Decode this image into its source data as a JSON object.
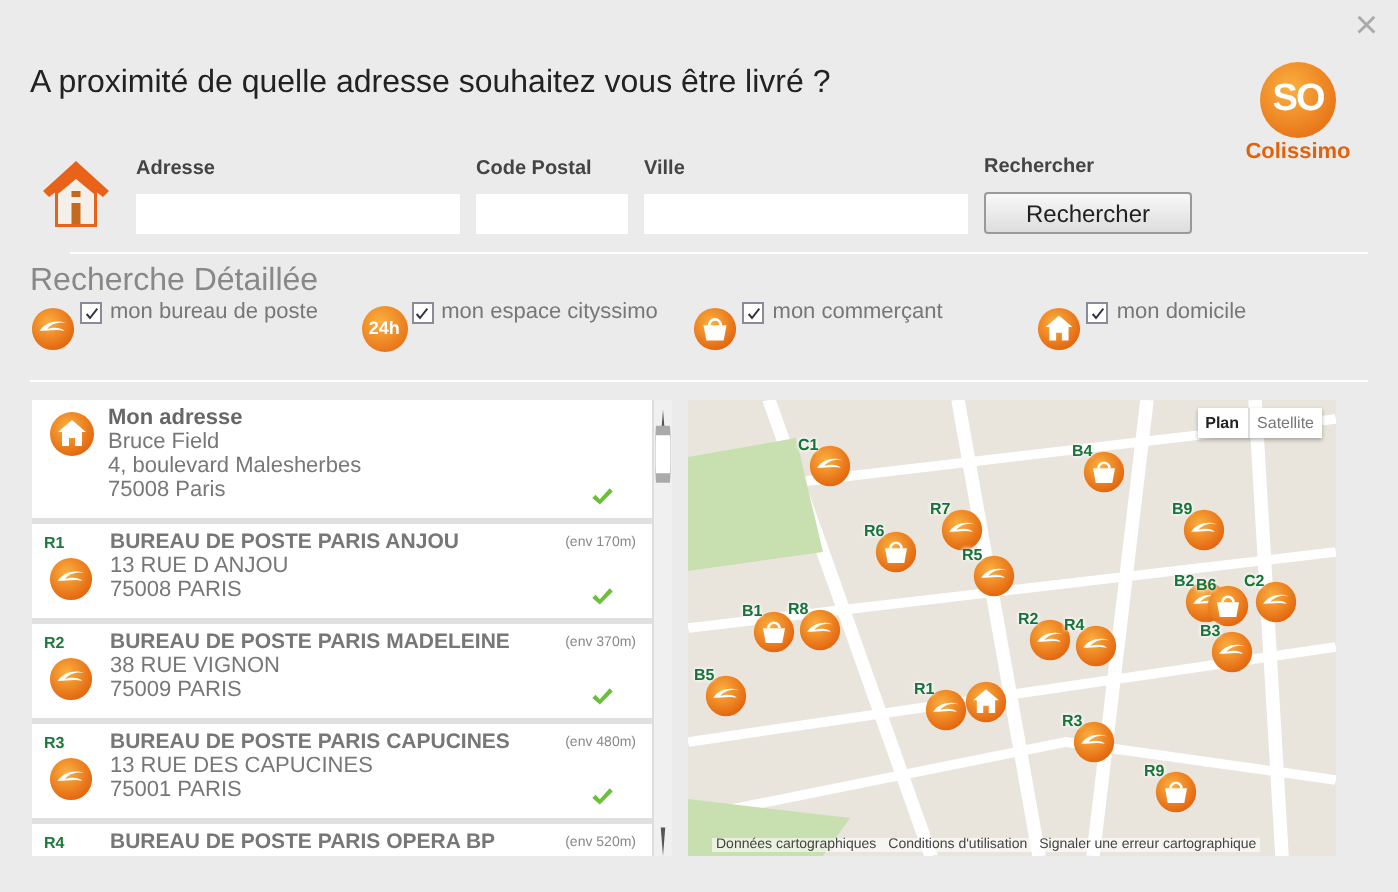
{
  "window": {
    "close": "×",
    "title": "A proximité de quelle adresse souhaitez vous être livré ?"
  },
  "logo": {
    "mark": "SO",
    "name": "Colissimo"
  },
  "search": {
    "fields": [
      {
        "label": "Adresse",
        "kind": "wide"
      },
      {
        "label": "Code Postal",
        "kind": "narrow"
      },
      {
        "label": "Ville",
        "kind": "wide"
      }
    ],
    "button_label": "Rechercher",
    "button": "Rechercher"
  },
  "filters": {
    "title": "Recherche Détaillée",
    "items": [
      {
        "kind": "poste",
        "label": "mon bureau de poste",
        "checked": true
      },
      {
        "kind": "cityssimo",
        "badge": "24h",
        "label": "mon espace cityssimo",
        "checked": true
      },
      {
        "kind": "shop",
        "label": "mon commerçant",
        "checked": true
      },
      {
        "kind": "home",
        "label": "mon domicile",
        "checked": true
      }
    ]
  },
  "results": [
    {
      "kind": "home",
      "title": "Mon adresse",
      "lines": [
        "Bruce Field",
        "4, boulevard Malesherbes",
        "75008  Paris"
      ],
      "checked": true
    },
    {
      "kind": "poste",
      "tag": "R1",
      "title": "BUREAU DE POSTE PARIS ANJOU",
      "distance": "(env 170m)",
      "lines": [
        "13 RUE D ANJOU",
        "75008 PARIS"
      ],
      "checked": true
    },
    {
      "kind": "poste",
      "tag": "R2",
      "title": "BUREAU DE POSTE PARIS MADELEINE",
      "distance": "(env 370m)",
      "lines": [
        "38 RUE VIGNON",
        "75009 PARIS"
      ],
      "checked": true
    },
    {
      "kind": "poste",
      "tag": "R3",
      "title": "BUREAU DE POSTE PARIS CAPUCINES",
      "distance": "(env 480m)",
      "lines": [
        "13 RUE DES CAPUCINES",
        "75001 PARIS"
      ],
      "checked": true
    },
    {
      "kind": "poste",
      "tag": "R4",
      "title": "BUREAU DE POSTE PARIS OPERA BP",
      "distance": "(env 520m)"
    }
  ],
  "map": {
    "tabs": [
      {
        "label": "Plan",
        "selected": true
      },
      {
        "label": "Satellite",
        "selected": false
      }
    ],
    "pins": [
      {
        "kind": "poste",
        "label": "C1"
      },
      {
        "kind": "shop",
        "label": "B4"
      },
      {
        "kind": "poste",
        "label": "R7"
      },
      {
        "kind": "shop",
        "label": "R6"
      },
      {
        "kind": "poste",
        "label": "B9"
      },
      {
        "kind": "poste",
        "label": "R5"
      },
      {
        "kind": "poste",
        "label": "B2"
      },
      {
        "kind": "shop",
        "label": "B6"
      },
      {
        "kind": "poste",
        "label": "C2"
      },
      {
        "kind": "shop",
        "label": "B1"
      },
      {
        "kind": "poste",
        "label": "R8"
      },
      {
        "kind": "poste",
        "label": "R2"
      },
      {
        "kind": "poste",
        "label": "R4"
      },
      {
        "kind": "poste",
        "label": "B3"
      },
      {
        "kind": "poste",
        "label": "B5"
      },
      {
        "kind": "poste",
        "label": "R1"
      },
      {
        "kind": "home"
      },
      {
        "kind": "poste",
        "label": "R3"
      },
      {
        "kind": "shop",
        "label": "R9"
      }
    ],
    "footer": [
      "Données cartographiques",
      "Conditions d'utilisation",
      "Signaler une erreur cartographique"
    ]
  }
}
